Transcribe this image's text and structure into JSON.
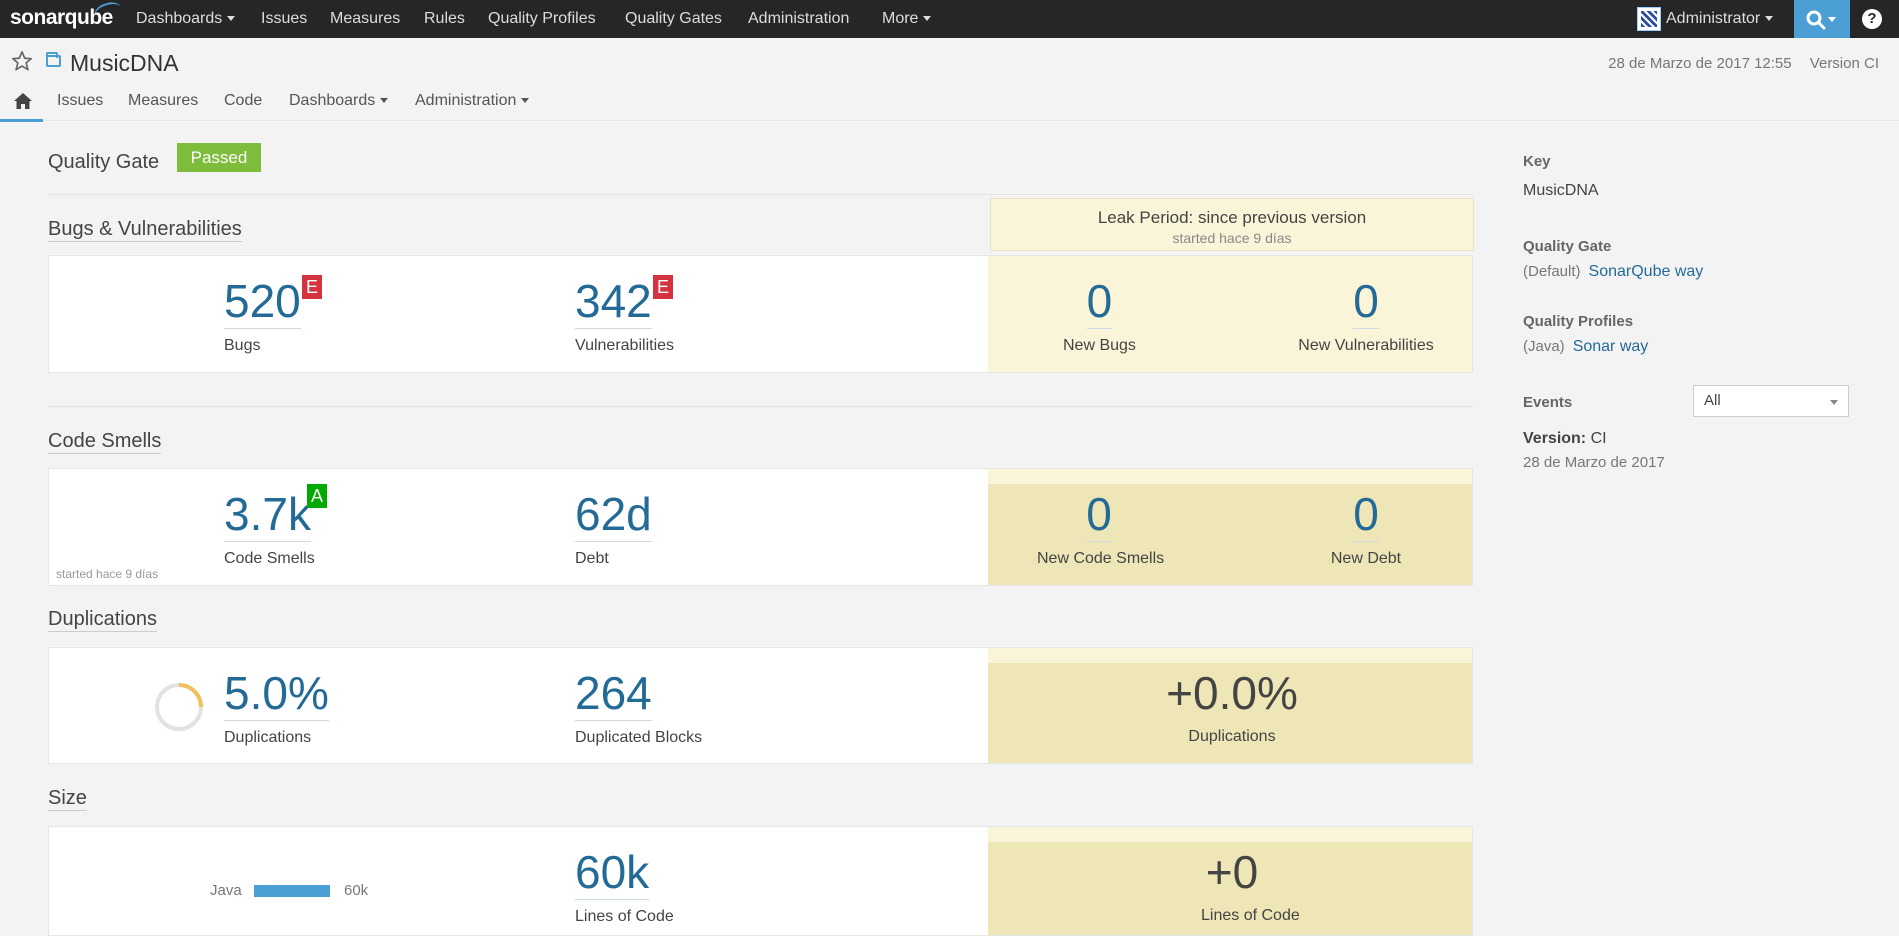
{
  "topnav": {
    "logo": "sonarqube",
    "items": [
      "Dashboards",
      "Issues",
      "Measures",
      "Rules",
      "Quality Profiles",
      "Quality Gates",
      "Administration",
      "More"
    ],
    "user": "Administrator",
    "help": "?"
  },
  "project": {
    "name": "MusicDNA",
    "date": "28 de Marzo de 2017 12:55",
    "version": "Version CI"
  },
  "subnav": {
    "items": [
      "Issues",
      "Measures",
      "Code",
      "Dashboards",
      "Administration"
    ]
  },
  "quality_gate": {
    "title": "Quality Gate",
    "status": "Passed",
    "status_color": "#7ebc3b"
  },
  "leak_period": {
    "title": "Leak Period: since previous version",
    "started": "started hace 9 días"
  },
  "bugs": {
    "title": "Bugs & Vulnerabilities",
    "bugs_value": "520",
    "bugs_rating": "E",
    "bugs_label": "Bugs",
    "vuln_value": "342",
    "vuln_rating": "E",
    "vuln_label": "Vulnerabilities",
    "new_bugs_value": "0",
    "new_bugs_label": "New Bugs",
    "new_vuln_value": "0",
    "new_vuln_label": "New Vulnerabilities"
  },
  "code_smells": {
    "title": "Code Smells",
    "value": "3.7k",
    "rating": "A",
    "label": "Code Smells",
    "debt_value": "62d",
    "debt_label": "Debt",
    "started": "started hace 9 días",
    "new_value": "0",
    "new_label": "New Code Smells",
    "new_debt_value": "0",
    "new_debt_label": "New Debt"
  },
  "duplications": {
    "title": "Duplications",
    "value": "5.0%",
    "percent": 5.0,
    "label": "Duplications",
    "blocks_value": "264",
    "blocks_label": "Duplicated Blocks",
    "new_value": "+0.0%",
    "new_label": "Duplications"
  },
  "size": {
    "title": "Size",
    "lang": "Java",
    "lang_value": "60k",
    "loc_value": "60k",
    "loc_label": "Lines of Code",
    "new_value": "+0",
    "new_label": "Lines of Code"
  },
  "sidebar": {
    "key_label": "Key",
    "key_value": "MusicDNA",
    "qg_label": "Quality Gate",
    "qg_prefix": "(Default)",
    "qg_link": "SonarQube way",
    "qp_label": "Quality Profiles",
    "qp_prefix": "(Java)",
    "qp_link": "Sonar way",
    "events_label": "Events",
    "events_filter": "All",
    "event_version_label": "Version:",
    "event_version_value": "CI",
    "event_date": "28 de Marzo de 2017"
  },
  "colors": {
    "accent": "#4b9fd5",
    "rating_e": "#d4333f",
    "rating_a": "#00aa00",
    "leak_bg": "#eee6b6"
  },
  "icons": [
    "star-icon",
    "project-icon",
    "home-icon",
    "search-icon",
    "help-icon",
    "avatar-icon"
  ]
}
